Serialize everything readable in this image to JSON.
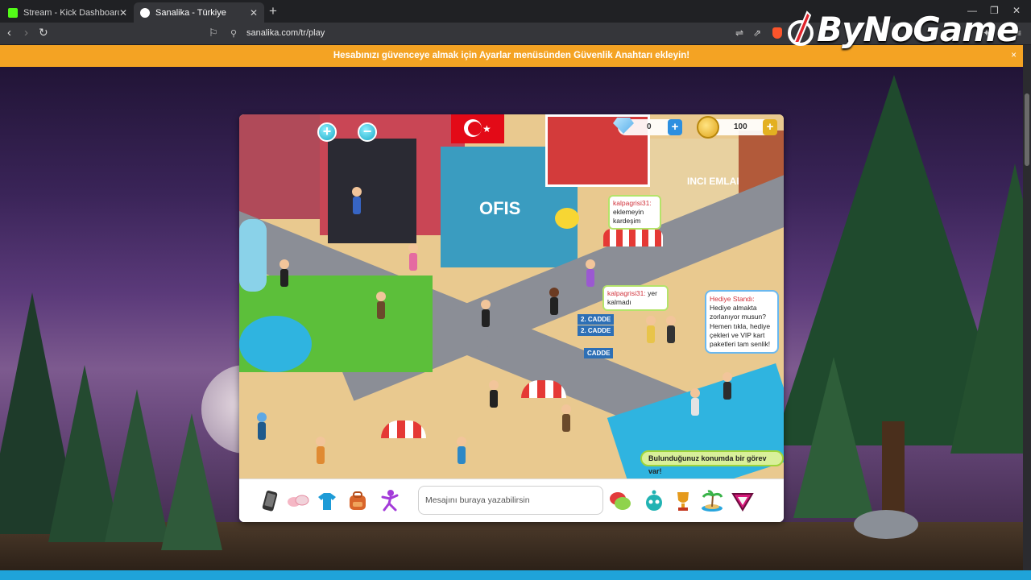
{
  "browser": {
    "tabs": [
      {
        "title": "Stream - Kick Dashboard",
        "favicon_color": "#53fc18",
        "active": false
      },
      {
        "title": "Sanalika - Türkiye",
        "favicon_color": "#ffffff",
        "active": true
      }
    ],
    "url": "sanalika.com/tr/play"
  },
  "watermark": {
    "text": "ByNoGame"
  },
  "notice": {
    "text": "Hesabınızı güvenceye almak için Ayarlar menüsünden Güvenlik Anahtarı ekleyin!"
  },
  "game": {
    "currency": {
      "diamonds": "0",
      "coins": "100"
    },
    "chat_bubbles": [
      {
        "user": "kalpagrisi31:",
        "text": "eklemeyin kardeşim"
      },
      {
        "user": "kalpagrisi31:",
        "text": "yer kalmadı"
      }
    ],
    "gift_stand": {
      "title": "Hediye Standı:",
      "text": "Hediye almakta zorlanıyor musun? Hemen tıkla, hediye çekleri ve VIP kart paketleri tam senlik!"
    },
    "signs": {
      "ofis": "OFIS",
      "emlak": "INCI EMLAK",
      "street1": "2. CADDE",
      "street2": "2. CADDE",
      "street3": "CADDE"
    },
    "quest_text": "Bulunduğunuz konumda bir görev var!",
    "chat_placeholder": "Mesajını buraya yazabilirsin"
  },
  "colors": {
    "notice": "#f4a323",
    "accent_green": "#9fd43a",
    "accent_blue": "#1fa3d9"
  }
}
